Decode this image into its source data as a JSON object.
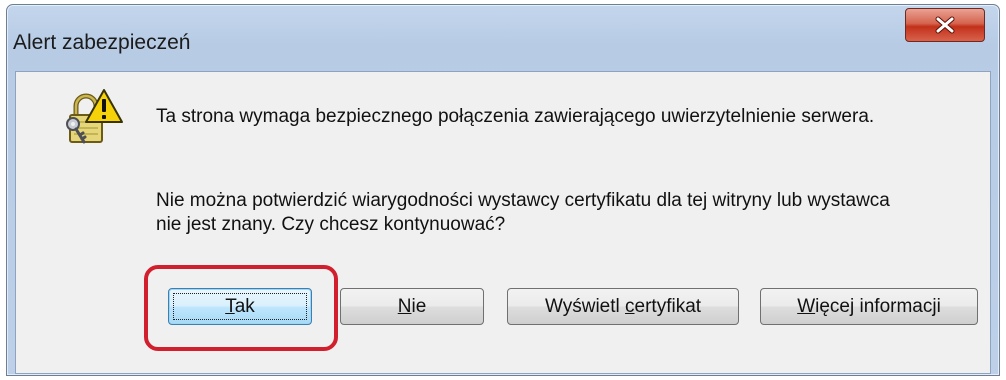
{
  "window": {
    "title": "Alert zabezpieczeń"
  },
  "icons": {
    "close": "close-x-icon",
    "security": "lock-key-warning-icon"
  },
  "message": {
    "line1": "Ta strona wymaga bezpiecznego połączenia zawierającego uwierzytelnienie serwera.",
    "line2": "Nie można potwierdzić wiarygodności wystawcy certyfikatu dla tej witryny lub wystawca",
    "line3": "nie jest znany. Czy chcesz kontynuować?"
  },
  "buttons": {
    "yes": {
      "pre": "",
      "key": "T",
      "post": "ak"
    },
    "no": {
      "pre": "",
      "key": "N",
      "post": "ie"
    },
    "view_cert": {
      "pre": "Wyświetl ",
      "key": "c",
      "post": "ertyfikat"
    },
    "more_info": {
      "pre": "",
      "key": "W",
      "post": "ięcej informacji"
    }
  },
  "colors": {
    "highlight": "#d21f2d",
    "close_button": "#c2311a"
  }
}
